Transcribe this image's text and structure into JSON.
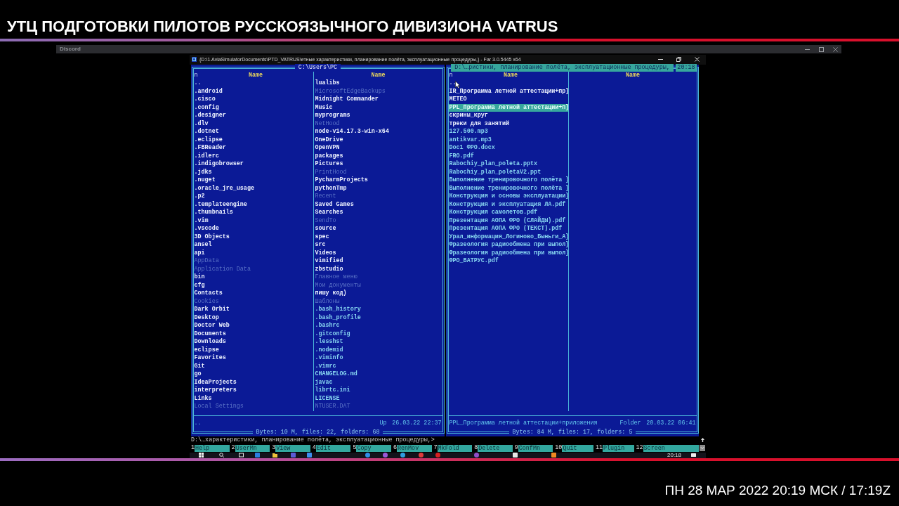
{
  "stream_title": "УТЦ ПОДГОТОВКИ ПИЛОТОВ РУССКОЯЗЫЧНОГО ДИВИЗИОНА VATRUS",
  "discord_window": {
    "title": "Discord"
  },
  "far_window": {
    "title": "{D:\\1.AviaSimulatorDocuments\\PTD_VATRUS\\етные характеристики, планирование полёта, эксплуатационные процедуры,} - Far 3.0.5445 x64"
  },
  "panels": [
    {
      "title": "C:\\Users\\PC",
      "active": false,
      "sort_mark": "n",
      "columns": [
        {
          "header": "Name",
          "items": [
            {
              "name": "..",
              "kind": "up",
              "selected": false
            },
            {
              "name": ".android",
              "kind": "folder",
              "selected": false
            },
            {
              "name": ".cisco",
              "kind": "folder",
              "selected": false
            },
            {
              "name": ".config",
              "kind": "folder",
              "selected": false
            },
            {
              "name": ".designer",
              "kind": "folder",
              "selected": false
            },
            {
              "name": ".dlv",
              "kind": "folder",
              "selected": false
            },
            {
              "name": ".dotnet",
              "kind": "folder",
              "selected": false
            },
            {
              "name": ".eclipse",
              "kind": "folder",
              "selected": false
            },
            {
              "name": ".FBReader",
              "kind": "folder",
              "selected": false
            },
            {
              "name": ".idlerc",
              "kind": "folder",
              "selected": false
            },
            {
              "name": ".indigobrowser",
              "kind": "folder",
              "selected": false
            },
            {
              "name": ".jdks",
              "kind": "folder",
              "selected": false
            },
            {
              "name": ".nuget",
              "kind": "folder",
              "selected": false
            },
            {
              "name": ".oracle_jre_usage",
              "kind": "folder",
              "selected": false
            },
            {
              "name": ".p2",
              "kind": "folder",
              "selected": false
            },
            {
              "name": ".templateengine",
              "kind": "folder",
              "selected": false
            },
            {
              "name": ".thumbnails",
              "kind": "folder",
              "selected": false
            },
            {
              "name": ".vim",
              "kind": "folder",
              "selected": false
            },
            {
              "name": ".vscode",
              "kind": "folder",
              "selected": false
            },
            {
              "name": "3D Objects",
              "kind": "folder",
              "selected": false
            },
            {
              "name": "ansel",
              "kind": "folder",
              "selected": false
            },
            {
              "name": "api",
              "kind": "folder",
              "selected": false
            },
            {
              "name": "AppData",
              "kind": "hidden",
              "selected": false
            },
            {
              "name": "Application Data",
              "kind": "hidden",
              "selected": false
            },
            {
              "name": "bin",
              "kind": "folder",
              "selected": false
            },
            {
              "name": "cfg",
              "kind": "folder",
              "selected": false
            },
            {
              "name": "Contacts",
              "kind": "folder",
              "selected": false
            },
            {
              "name": "Cookies",
              "kind": "hidden",
              "selected": false
            },
            {
              "name": "Dark Orbit",
              "kind": "folder",
              "selected": false
            },
            {
              "name": "Desktop",
              "kind": "folder",
              "selected": false
            },
            {
              "name": "Doctor Web",
              "kind": "folder",
              "selected": false
            },
            {
              "name": "Documents",
              "kind": "folder",
              "selected": false
            },
            {
              "name": "Downloads",
              "kind": "folder",
              "selected": false
            },
            {
              "name": "eclipse",
              "kind": "folder",
              "selected": false
            },
            {
              "name": "Favorites",
              "kind": "folder",
              "selected": false
            },
            {
              "name": "Git",
              "kind": "folder",
              "selected": false
            },
            {
              "name": "go",
              "kind": "folder",
              "selected": false
            },
            {
              "name": "IdeaProjects",
              "kind": "folder",
              "selected": false
            },
            {
              "name": "interpreters",
              "kind": "folder",
              "selected": false
            },
            {
              "name": "Links",
              "kind": "folder",
              "selected": false
            },
            {
              "name": "Local Settings",
              "kind": "hidden",
              "selected": false
            }
          ]
        },
        {
          "header": "Name",
          "items": [
            {
              "name": "lualibs",
              "kind": "folder",
              "selected": false
            },
            {
              "name": "MicrosoftEdgeBackups",
              "kind": "hidden",
              "selected": false
            },
            {
              "name": "Midnight Commander",
              "kind": "folder",
              "selected": false
            },
            {
              "name": "Music",
              "kind": "folder",
              "selected": false
            },
            {
              "name": "myprograms",
              "kind": "folder",
              "selected": false
            },
            {
              "name": "NetHood",
              "kind": "hidden",
              "selected": false
            },
            {
              "name": "node-v14.17.3-win-x64",
              "kind": "folder",
              "selected": false
            },
            {
              "name": "OneDrive",
              "kind": "folder",
              "selected": false
            },
            {
              "name": "OpenVPN",
              "kind": "folder",
              "selected": false
            },
            {
              "name": "packages",
              "kind": "folder",
              "selected": false
            },
            {
              "name": "Pictures",
              "kind": "folder",
              "selected": false
            },
            {
              "name": "PrintHood",
              "kind": "hidden",
              "selected": false
            },
            {
              "name": "PycharmProjects",
              "kind": "folder",
              "selected": false
            },
            {
              "name": "pythonTmp",
              "kind": "folder",
              "selected": false
            },
            {
              "name": "Recent",
              "kind": "hidden",
              "selected": false
            },
            {
              "name": "Saved Games",
              "kind": "folder",
              "selected": false
            },
            {
              "name": "Searches",
              "kind": "folder",
              "selected": false
            },
            {
              "name": "SendTo",
              "kind": "hidden",
              "selected": false
            },
            {
              "name": "source",
              "kind": "folder",
              "selected": false
            },
            {
              "name": "spec",
              "kind": "folder",
              "selected": false
            },
            {
              "name": "src",
              "kind": "folder",
              "selected": false
            },
            {
              "name": "Videos",
              "kind": "folder",
              "selected": false
            },
            {
              "name": "vimified",
              "kind": "folder",
              "selected": false
            },
            {
              "name": "zbstudio",
              "kind": "folder",
              "selected": false
            },
            {
              "name": "Главное меню",
              "kind": "hidden",
              "selected": false
            },
            {
              "name": "Мои документы",
              "kind": "hidden",
              "selected": false
            },
            {
              "name": "пишу код)",
              "kind": "folder",
              "selected": false
            },
            {
              "name": "Шаблоны",
              "kind": "hidden",
              "selected": false
            },
            {
              "name": ".bash_history",
              "kind": "file",
              "selected": false
            },
            {
              "name": ".bash_profile",
              "kind": "file",
              "selected": false
            },
            {
              "name": ".bashrc",
              "kind": "file",
              "selected": false
            },
            {
              "name": ".gitconfig",
              "kind": "file",
              "selected": false
            },
            {
              "name": ".lesshst",
              "kind": "file",
              "selected": false
            },
            {
              "name": ".nodemid",
              "kind": "file",
              "selected": false
            },
            {
              "name": ".viminfo",
              "kind": "file",
              "selected": false
            },
            {
              "name": ".vimrc",
              "kind": "file",
              "selected": false
            },
            {
              "name": "CHANGELOG.md",
              "kind": "file",
              "selected": false
            },
            {
              "name": "javac",
              "kind": "file",
              "selected": false
            },
            {
              "name": "librtc.ini",
              "kind": "file",
              "selected": false
            },
            {
              "name": "LICENSE",
              "kind": "file",
              "selected": false
            },
            {
              "name": "NTUSER.DAT",
              "kind": "hidden",
              "selected": false
            }
          ]
        }
      ],
      "status": {
        "name": "..",
        "type": "Up",
        "date": "26.03.22 22:37"
      },
      "summary": "Bytes: 10 M, files: 22, folders: 68"
    },
    {
      "title": "D:\\…ристики, планирование полёта, эксплуатационные процедуры,",
      "clock": "20:18",
      "active": true,
      "sort_mark": "n",
      "columns": [
        {
          "header": "Name",
          "items": [
            {
              "name": "..",
              "kind": "up",
              "selected": false
            },
            {
              "name": "IR_Программа летной аттестации+пр}",
              "kind": "folder",
              "selected": false
            },
            {
              "name": "METEO",
              "kind": "folder",
              "selected": false
            },
            {
              "name": "PPL_Программа летной аттестации+п}",
              "kind": "folder",
              "selected": true
            },
            {
              "name": "скрины_круг",
              "kind": "folder",
              "selected": false
            },
            {
              "name": "треки для занятий",
              "kind": "folder",
              "selected": false
            },
            {
              "name": "127.500.mp3",
              "kind": "file",
              "selected": false
            },
            {
              "name": "antikvar.mp3",
              "kind": "file",
              "selected": false
            },
            {
              "name": "Doc1 ФРО.docx",
              "kind": "file",
              "selected": false
            },
            {
              "name": "FRO.pdf",
              "kind": "file",
              "selected": false
            },
            {
              "name": "Rabochiy_plan_poleta.pptx",
              "kind": "file",
              "selected": false
            },
            {
              "name": "Rabochiy_plan_poletaV2.ppt",
              "kind": "file",
              "selected": false
            },
            {
              "name": "Выполнение тренировочного полёта }",
              "kind": "file",
              "selected": false
            },
            {
              "name": "Выполнение тренировочного полёта }",
              "kind": "file",
              "selected": false
            },
            {
              "name": "Конструкция и основы эксплуатации}",
              "kind": "file",
              "selected": false
            },
            {
              "name": "Конструкция и эксплуатация ЛА.pdf",
              "kind": "file",
              "selected": false
            },
            {
              "name": "Конструкция самолетов.pdf",
              "kind": "file",
              "selected": false
            },
            {
              "name": "Презентация АОПА ФРО (СЛАЙДЫ).pdf",
              "kind": "file",
              "selected": false
            },
            {
              "name": "Презентация АОПА ФРО (ТЕКСТ).pdf",
              "kind": "file",
              "selected": false
            },
            {
              "name": "Урал_информация_Логиново_Быньги_А}",
              "kind": "file",
              "selected": false
            },
            {
              "name": "Фразеология радиообмена при выпол}",
              "kind": "file",
              "selected": false
            },
            {
              "name": "Фразеология радиообмена при выпол}",
              "kind": "file",
              "selected": false
            },
            {
              "name": "ФРО_ВАТРУС.pdf",
              "kind": "file",
              "selected": false
            }
          ]
        },
        {
          "header": "Name"
        }
      ],
      "status": {
        "name": "PPL_Программа летной аттестации+приложения",
        "type": "Folder",
        "date": "20.03.22 06:41"
      },
      "summary": "Bytes: 84 M, files: 17, folders: 5"
    }
  ],
  "command_line": "D:\\…характеристики, планирование полёта, эксплуатационные процедуры,>",
  "key_bar": [
    {
      "number": "1",
      "label": "Help"
    },
    {
      "number": "2",
      "label": "UserMn"
    },
    {
      "number": "3",
      "label": "View"
    },
    {
      "number": "4",
      "label": "Edit"
    },
    {
      "number": "5",
      "label": "Copy"
    },
    {
      "number": "6",
      "label": "RenMov"
    },
    {
      "number": "7",
      "label": "MkFold"
    },
    {
      "number": "8",
      "label": "Delete"
    },
    {
      "number": "9",
      "label": "ConfMn"
    },
    {
      "number": "10",
      "label": "Quit"
    },
    {
      "number": "11",
      "label": "Plugin"
    },
    {
      "number": "12",
      "label": "Screen"
    }
  ],
  "taskbar": {
    "clock": "20:18"
  },
  "broadcast_time": "ПН 28 МАР 2022 20:19 МСК / 17:19Z"
}
